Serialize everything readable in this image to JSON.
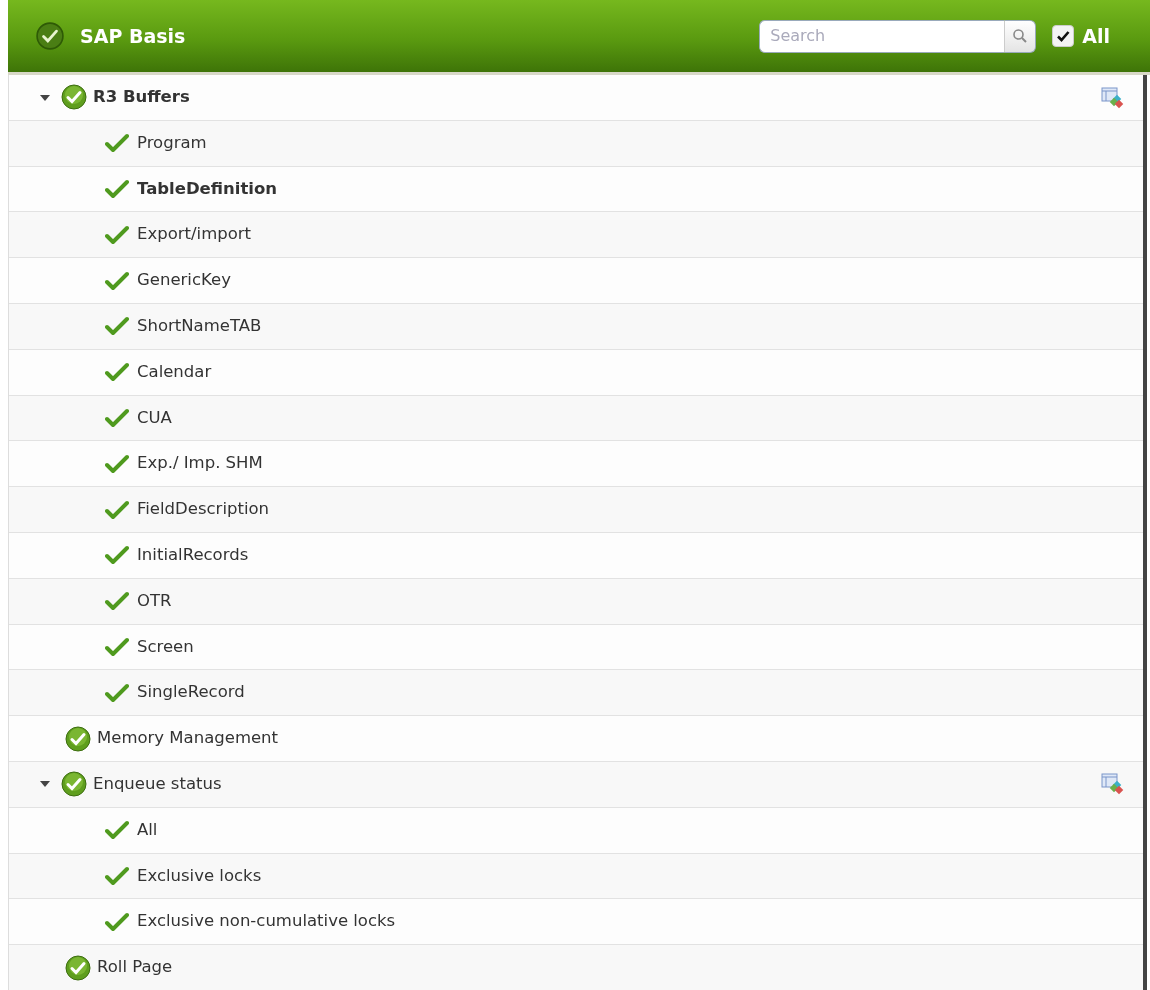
{
  "header": {
    "title": "SAP Basis",
    "search": {
      "placeholder": "Search"
    },
    "all_filter": {
      "label": "All",
      "checked": true
    }
  },
  "groups": [
    {
      "name": "R3 Buffers",
      "bold": true,
      "expanded": true,
      "has_action": true,
      "children": [
        {
          "name": "Program",
          "bold": false
        },
        {
          "name": "TableDefinition",
          "bold": true
        },
        {
          "name": "Export/import",
          "bold": false
        },
        {
          "name": "GenericKey",
          "bold": false
        },
        {
          "name": "ShortNameTAB",
          "bold": false
        },
        {
          "name": "Calendar",
          "bold": false
        },
        {
          "name": "CUA",
          "bold": false
        },
        {
          "name": "Exp./ Imp. SHM",
          "bold": false
        },
        {
          "name": "FieldDescription",
          "bold": false
        },
        {
          "name": "InitialRecords",
          "bold": false
        },
        {
          "name": "OTR",
          "bold": false
        },
        {
          "name": "Screen",
          "bold": false
        },
        {
          "name": "SingleRecord",
          "bold": false
        }
      ]
    },
    {
      "name": "Memory Management",
      "bold": false,
      "has_action": false
    },
    {
      "name": "Enqueue status",
      "bold": false,
      "expanded": true,
      "has_action": true,
      "children": [
        {
          "name": "All",
          "bold": false
        },
        {
          "name": "Exclusive locks",
          "bold": false
        },
        {
          "name": "Exclusive non-cumulative locks",
          "bold": false
        }
      ]
    },
    {
      "name": "Roll Page",
      "bold": false,
      "has_action": false
    }
  ]
}
